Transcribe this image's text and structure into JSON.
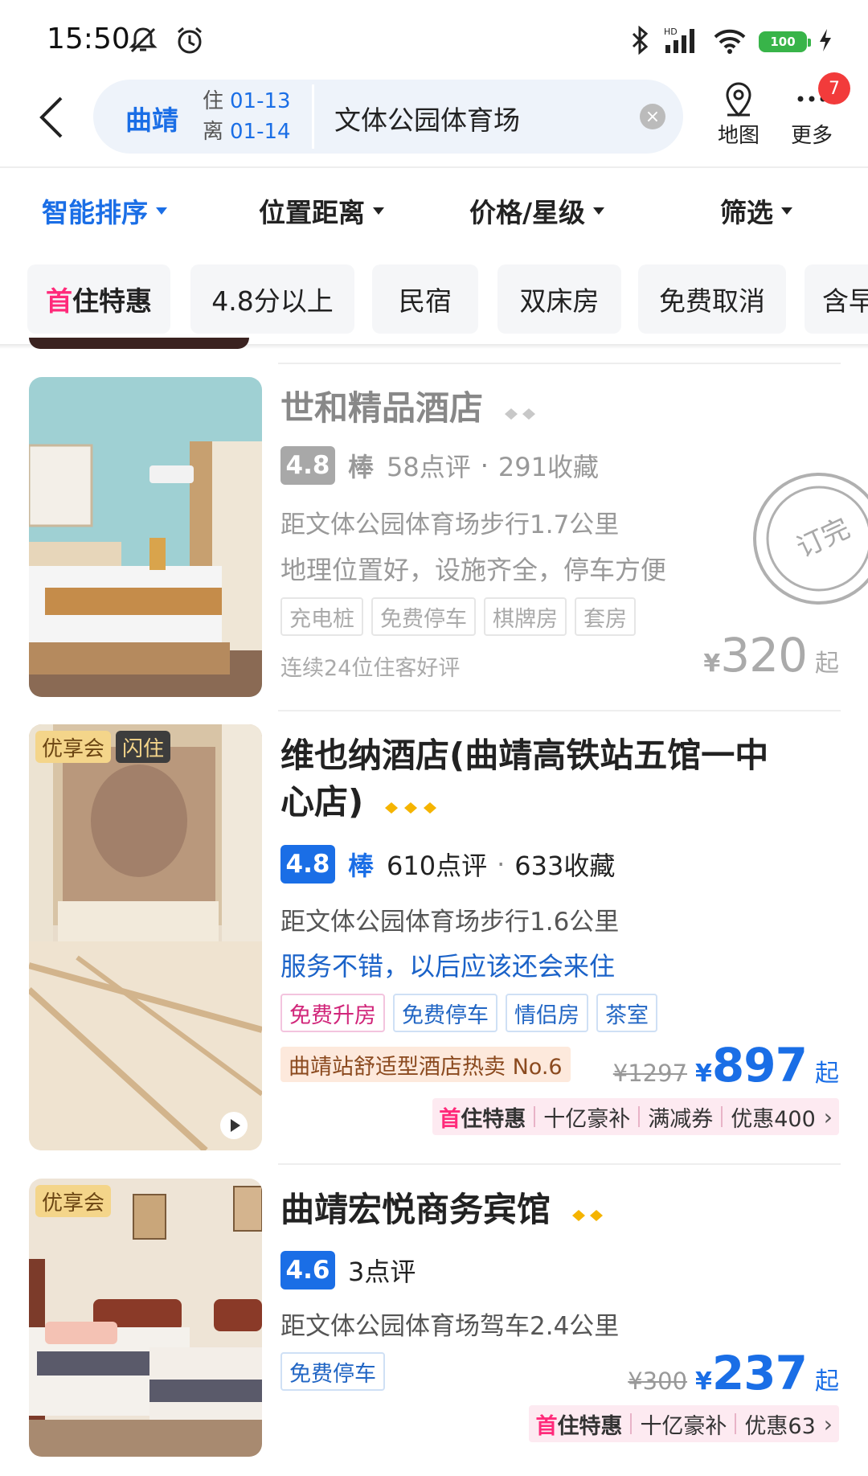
{
  "status_bar": {
    "time": "15:50",
    "battery": "100"
  },
  "search": {
    "city": "曲靖",
    "checkin_label": "住",
    "checkin_date": "01-13",
    "checkout_label": "离",
    "checkout_date": "01-14",
    "keyword": "文体公园体育场"
  },
  "header_actions": {
    "map_label": "地图",
    "more_label": "更多",
    "more_badge": "7"
  },
  "sort_bar": [
    "智能排序",
    "位置距离",
    "价格/星级",
    "筛选"
  ],
  "chips": [
    {
      "brand": "首",
      "label": "住特惠"
    },
    {
      "label": "4.8分以上"
    },
    {
      "label": "民宿"
    },
    {
      "label": "双床房"
    },
    {
      "label": "免费取消"
    },
    {
      "label": "含早"
    }
  ],
  "hotels": [
    {
      "name": "世和精品酒店",
      "diamonds": 2,
      "score": "4.8",
      "score_word": "棒",
      "reviews": "58点评",
      "favorites": "291收藏",
      "distance": "距文体公园体育场步行1.7公里",
      "quote": "地理位置好，设施齐全，停车方便",
      "amenities": [
        "充电桩",
        "免费停车",
        "棋牌房",
        "套房"
      ],
      "note": "连续24位住客好评",
      "currency": "¥",
      "price": "320",
      "price_suffix": "起",
      "stamp": "订完"
    },
    {
      "name": "维也纳酒店(曲靖高铁站五馆一中心店)",
      "name_line1": "维也纳酒店(曲靖高铁站五馆一中",
      "name_line2": "心店)",
      "diamonds": 3,
      "tags": [
        "优享会",
        "闪住"
      ],
      "score": "4.8",
      "score_word": "棒",
      "reviews": "610点评",
      "favorites": "633收藏",
      "distance": "距文体公园体育场步行1.6公里",
      "quote": "服务不错，以后应该还会来住",
      "amenities": [
        "免费升房",
        "免费停车",
        "情侣房",
        "茶室"
      ],
      "rank": "曲靖站舒适型酒店热卖 No.6",
      "old_price": "¥1297",
      "currency": "¥",
      "price": "897",
      "price_suffix": "起",
      "promo": {
        "brand": "首",
        "brand_rest": "住特惠",
        "items": [
          "十亿豪补",
          "满减券",
          "优惠400"
        ]
      }
    },
    {
      "name": "曲靖宏悦商务宾馆",
      "diamonds": 2,
      "tags": [
        "优享会"
      ],
      "score": "4.6",
      "reviews": "3点评",
      "distance": "距文体公园体育场驾车2.4公里",
      "amenities": [
        "免费停车"
      ],
      "old_price": "¥300",
      "currency": "¥",
      "price": "237",
      "price_suffix": "起",
      "promo": {
        "brand": "首",
        "brand_rest": "住特惠",
        "items": [
          "十亿豪补",
          "优惠63"
        ]
      }
    }
  ],
  "colors": {
    "accent": "#1a6ee6",
    "brand_pink": "#ff2a7a",
    "diamond": "#f5b400"
  }
}
